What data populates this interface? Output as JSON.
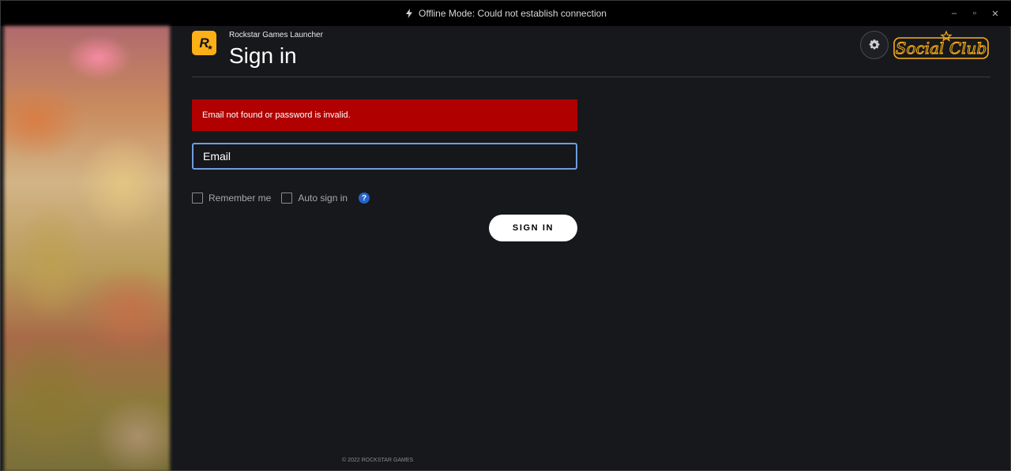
{
  "titlebar": {
    "status_text": "Offline Mode: Could not establish connection",
    "icon": "lightning-bolt-icon",
    "controls": [
      "minimize-icon",
      "maximize-icon",
      "close-icon"
    ],
    "minimize_glyph": "–",
    "maximize_glyph": "▫",
    "close_glyph": "✕"
  },
  "header": {
    "logo_letter": "R",
    "app_name": "Rockstar Games Launcher",
    "title": "Sign in",
    "settings_icon": "gear-icon",
    "brand": "Social Club"
  },
  "form": {
    "error_message": "Email not found or password is invalid.",
    "email_placeholder": "Email",
    "email_value": "",
    "remember_me_label": "Remember me",
    "auto_sign_in_label": "Auto sign in",
    "help_glyph": "?",
    "sign_in_label": "SIGN IN"
  },
  "footer": {
    "copyright": "© 2022 ROCKSTAR GAMES"
  },
  "colors": {
    "accent_logo": "#fcaf17",
    "error_bg": "#b00000",
    "focus_border": "#6f9de0",
    "help_icon": "#2465c7",
    "background": "#17181b"
  }
}
